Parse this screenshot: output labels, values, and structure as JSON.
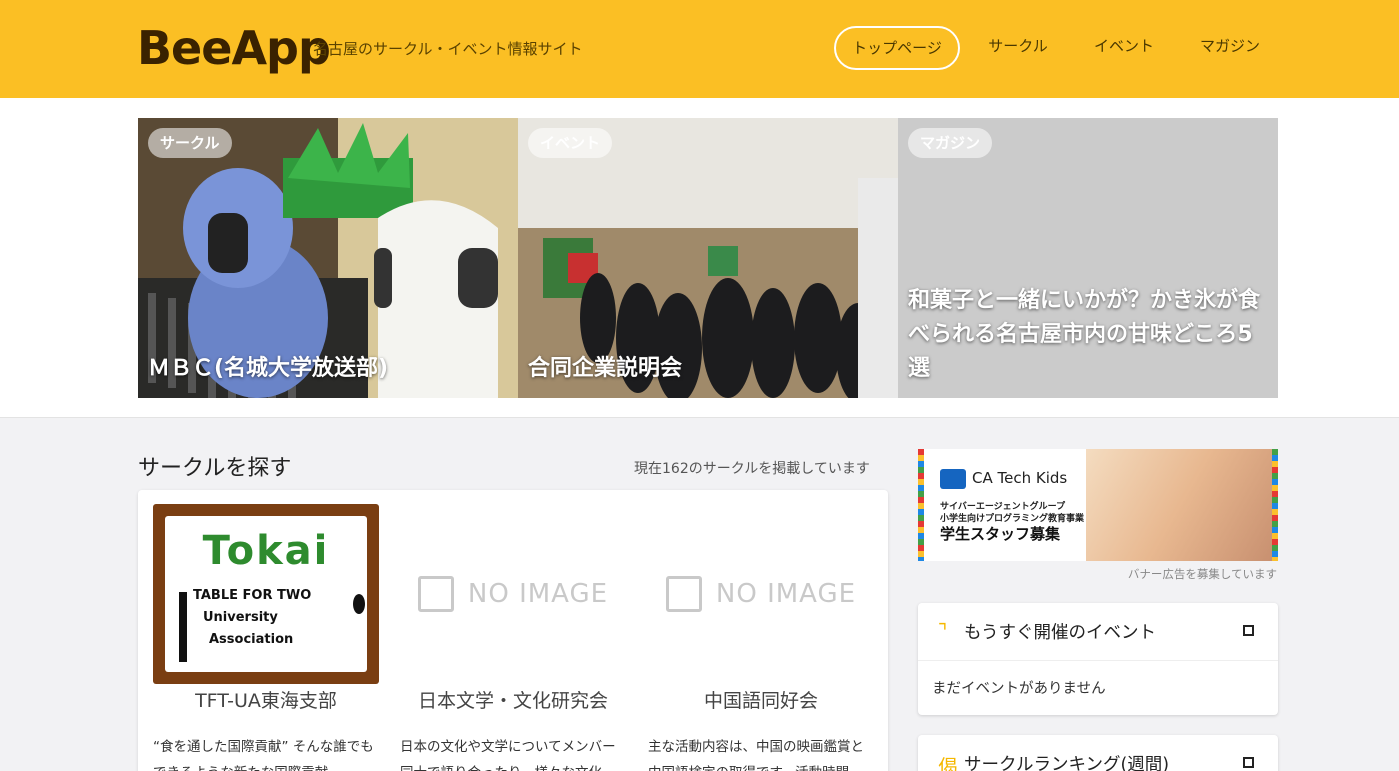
{
  "header": {
    "logo": "BeeApp",
    "tagline": "名古屋のサークル・イベント情報サイト",
    "nav": [
      "トップページ",
      "サークル",
      "イベント",
      "マガジン"
    ],
    "active_nav": "トップページ",
    "colors": {
      "brand": "#fbbf24",
      "logo": "#3a2200"
    }
  },
  "hero": [
    {
      "badge": "サークル",
      "title": "ＭＢＣ(名城大学放送部)"
    },
    {
      "badge": "イベント",
      "title": "合同企業説明会"
    },
    {
      "badge": "マガジン",
      "title": "和菓子と一緒にいかが？かき氷が食べられる名古屋市内の甘味どころ5選"
    }
  ],
  "circles_section": {
    "title": "サークルを探す",
    "count_text": "現在162のサークルを掲載しています",
    "noimage_text": "NO IMAGE",
    "items": [
      {
        "name": "TFT-UA東海支部",
        "desc": "“食を通した国際貢献” そんな誰でもできるような新たな国際貢献",
        "logo": {
          "word": "Tokai",
          "lines": [
            "TABLE FOR TWO",
            "University",
            "Association"
          ]
        }
      },
      {
        "name": "日本文学・文化研究会",
        "desc": "日本の文化や文学についてメンバー同士で語り合ったり、様々な文化"
      },
      {
        "name": "中国語同好会",
        "desc": "主な活動内容は、中国の映画鑑賞と中国語検定の取得です。活動時間"
      }
    ]
  },
  "sidebar": {
    "banner": {
      "brand": "CA Tech Kids",
      "line1": "サイバーエージェントグループ",
      "line2": "小学生向けプログラミング教育事業",
      "headline": "学生スタッフ募集"
    },
    "banner_note": "バナー広告を募集しています",
    "events_widget": {
      "icon": "hook-icon",
      "title": "もうすぐ開催のイベント",
      "empty": "まだイベントがありません"
    },
    "ranking_widget": {
      "icon": "ranking-icon",
      "title": "サークルランキング(週間)"
    }
  }
}
